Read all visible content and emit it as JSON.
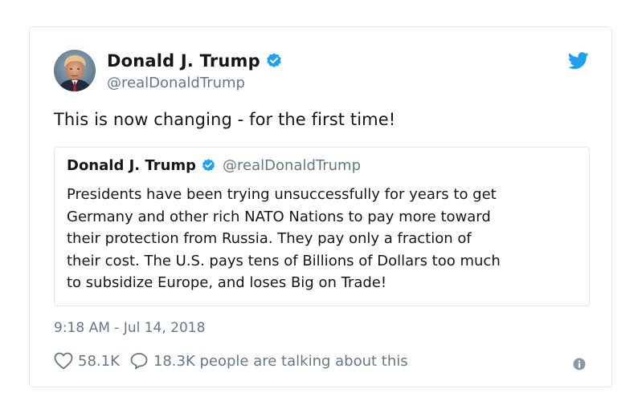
{
  "author": {
    "name": "Donald J. Trump",
    "handle": "@realDonaldTrump",
    "avatar_icon": "user-avatar-photo",
    "verified_icon": "verified-badge-icon"
  },
  "tweet": {
    "text": "This is now changing - for the first time!",
    "timestamp": "9:18 AM - Jul 14, 2018",
    "likes": "58.1K",
    "conversation": "18.3K people are talking about this"
  },
  "quoted_tweet": {
    "name": "Donald J. Trump",
    "handle": "@realDonaldTrump",
    "lines": [
      "Presidents have been trying unsuccessfully for years to get",
      "Germany and other rich NATO Nations to pay more toward",
      "their protection from Russia. They pay only a fraction of",
      "their cost. The U.S. pays tens of Billions of Dollars too much",
      "to subsidize Europe, and loses Big on Trade!"
    ]
  },
  "icons": {
    "brand": "twitter-bird-icon",
    "like": "heart-icon",
    "reply": "speech-bubble-icon",
    "info": "info-icon"
  },
  "colors": {
    "brand_blue": "#1da1f2",
    "text": "#14171a",
    "secondary_text": "#657786",
    "border": "#e1e8ed"
  }
}
